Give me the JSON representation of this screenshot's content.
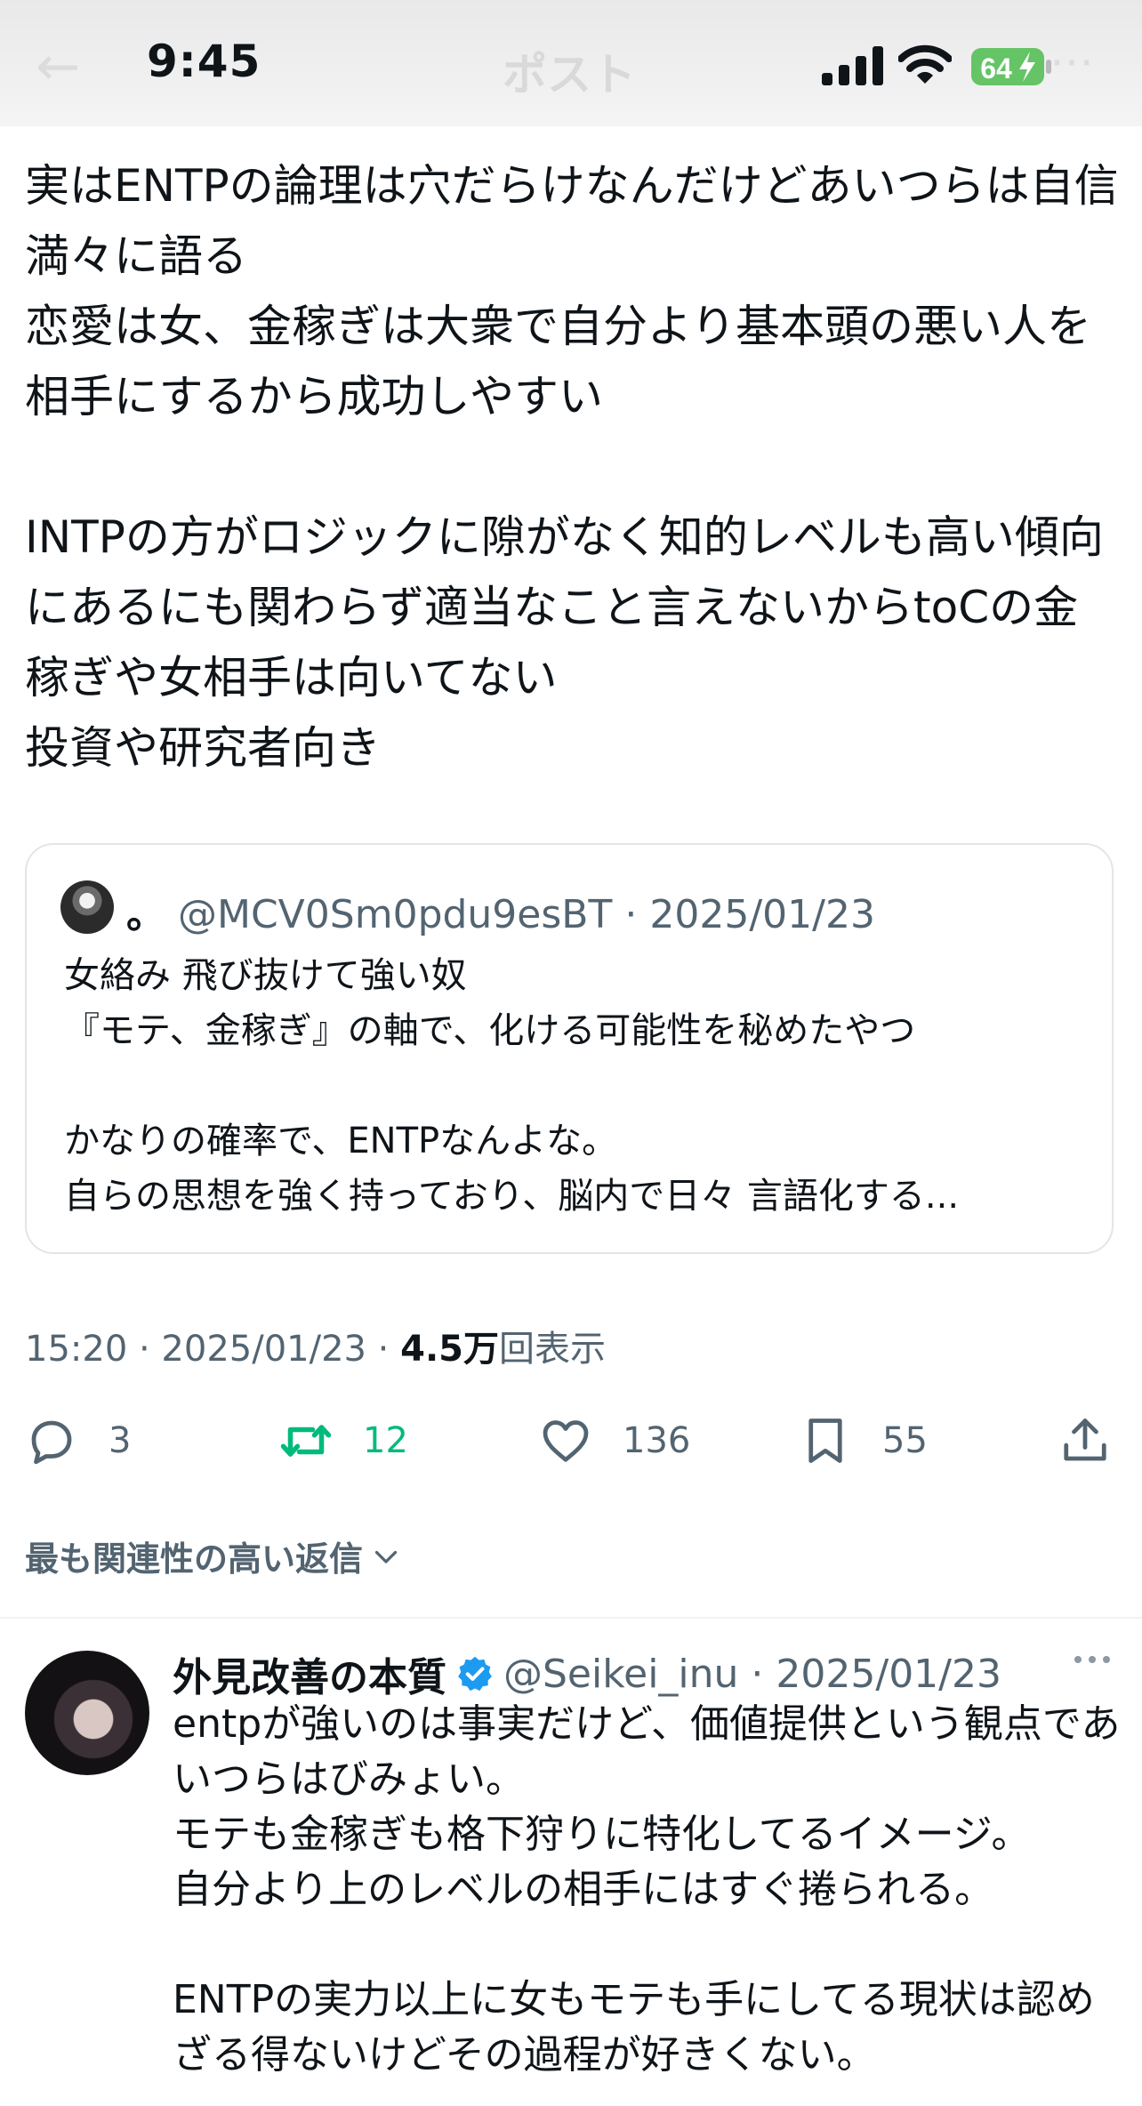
{
  "status_bar": {
    "time": "9:45",
    "battery": "64",
    "nav_title": "ポスト"
  },
  "post": {
    "text": "実はENTPの論理は穴だらけなんだけどあいつらは自信満々に語る\n恋愛は女、金稼ぎは大衆で自分より基本頭の悪い人を相手にするから成功しやすい\n\nINTPの方がロジックに隙がなく知的レベルも高い傾向にあるにも関わらず適当なこと言えないからtoCの金稼ぎや女相手は向いてない\n投資や研究者向き",
    "quote": {
      "name": "。",
      "handle": "@MCV0Sm0pdu9esBT",
      "date": "· 2025/01/23",
      "text": "女絡み 飛び抜けて強い奴\n『モテ、金稼ぎ』の軸で、化ける可能性を秘めたやつ\n\nかなりの確率で、ENTPなんよな。\n自らの思想を強く持っており、脳内で日々 言語化する..."
    },
    "meta": {
      "time_date": "15:20 · 2025/01/23 · ",
      "views_count": "4.5万",
      "views_label": "回表示"
    },
    "actions": {
      "replies": "3",
      "retweets": "12",
      "likes": "136",
      "bookmarks": "55"
    }
  },
  "replies_filter": {
    "label": "最も関連性の高い返信"
  },
  "reply": {
    "name": "外見改善の本質",
    "handle": "@Seikei_inu · 2025/01/23",
    "text": "entpが強いのは事実だけど、価値提供という観点であいつらはびみょい。\nモテも金稼ぎも格下狩りに特化してるイメージ。\n自分より上のレベルの相手にはすぐ捲られる。\n\nENTPの実力以上に女もモテも手にしてる現状は認めざる得ないけどその過程が好きくない。"
  },
  "colors": {
    "text": "#0f1419",
    "secondary": "#536471",
    "retweet_green": "#00ba7c",
    "verified_blue": "#1d9bf0",
    "battery_green": "#65c466"
  },
  "icons": [
    "back-arrow-icon",
    "signal-icon",
    "wifi-icon",
    "battery-icon",
    "reply-icon",
    "retweet-icon",
    "like-icon",
    "bookmark-icon",
    "share-icon",
    "chevron-down-icon",
    "verified-badge-icon",
    "more-icon"
  ]
}
